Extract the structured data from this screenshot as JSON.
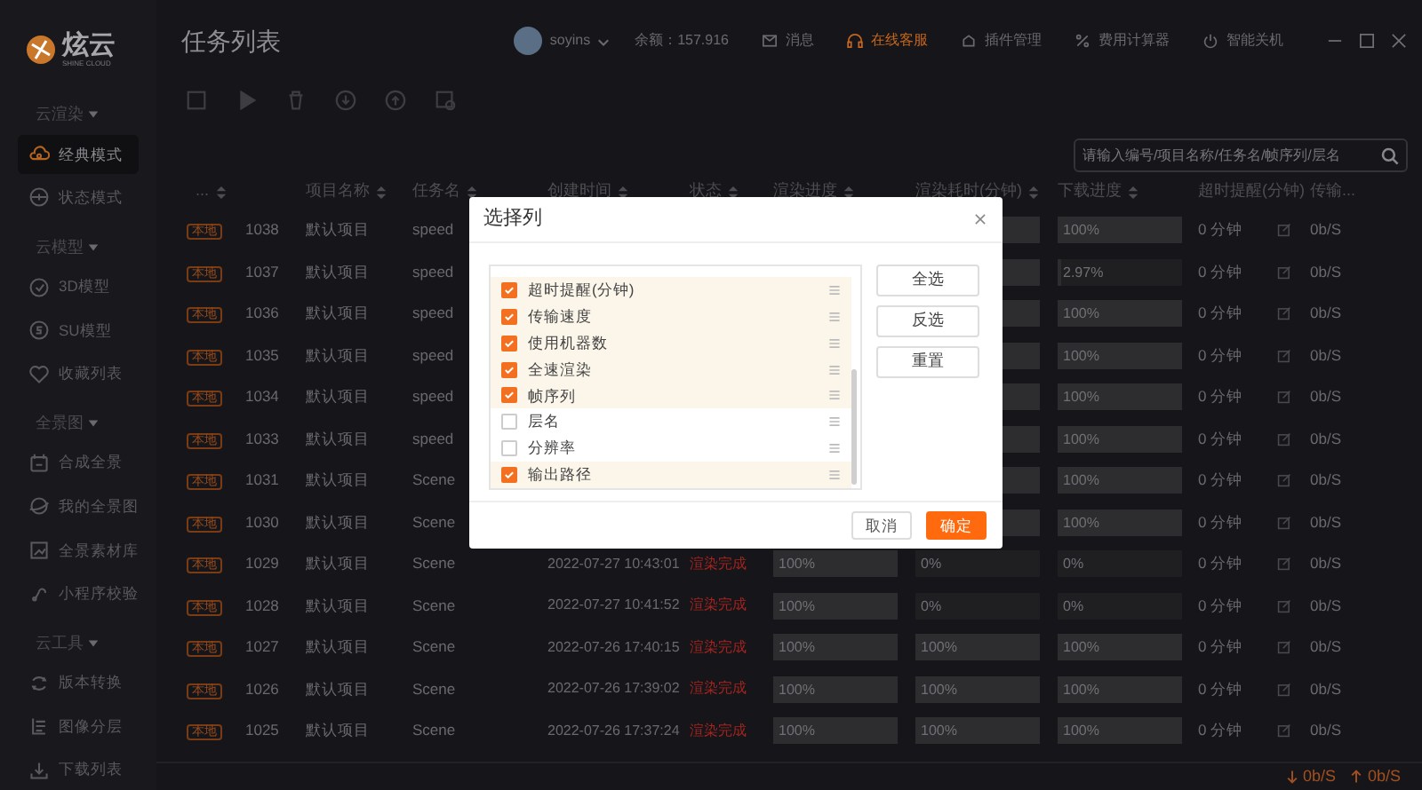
{
  "sidebar": {
    "logo": {
      "name": "炫云",
      "subtitle": "SHINE CLOUD"
    },
    "groups": [
      {
        "title": "云渲染",
        "items": [
          {
            "label": "经典模式",
            "selected": true
          },
          {
            "label": "状态模式",
            "selected": false
          }
        ]
      },
      {
        "title": "云模型",
        "items": [
          {
            "label": "3D模型",
            "selected": false
          },
          {
            "label": "SU模型",
            "selected": false
          },
          {
            "label": "收藏列表",
            "selected": false
          }
        ]
      },
      {
        "title": "全景图",
        "items": [
          {
            "label": "合成全景",
            "selected": false
          },
          {
            "label": "我的全景图",
            "selected": false
          },
          {
            "label": "全景素材库",
            "selected": false
          },
          {
            "label": "小程序校验",
            "selected": false
          }
        ]
      },
      {
        "title": "云工具",
        "items": [
          {
            "label": "版本转换",
            "selected": false
          },
          {
            "label": "图像分层",
            "selected": false
          },
          {
            "label": "下载列表",
            "selected": false
          }
        ]
      }
    ]
  },
  "header": {
    "title": "任务列表",
    "user": "soyins",
    "balance": "余额：157.916",
    "actions": [
      {
        "label": "消息",
        "selected": false
      },
      {
        "label": "在线客服",
        "selected": true
      },
      {
        "label": "插件管理",
        "selected": false
      },
      {
        "label": "费用计算器",
        "selected": false
      },
      {
        "label": "智能关机",
        "selected": false
      }
    ]
  },
  "search": {
    "placeholder": "请输入编号/项目名称/任务名/帧序列/层名"
  },
  "table": {
    "columns": [
      "...",
      "项目名称",
      "任务名",
      "创建时间",
      "状态",
      "渲染进度",
      "渲染耗时(分钟)",
      "下载进度",
      "超时提醒(分钟)",
      "传输..."
    ],
    "rows": [
      {
        "tag": "本地",
        "id": "1038",
        "project": "默认项目",
        "task": "speed",
        "elapsed": {
          "level": 1
        },
        "download": {
          "text": "100%",
          "level": 1
        },
        "timeout": "0 分钟",
        "speed": "0b/S"
      },
      {
        "tag": "本地",
        "id": "1037",
        "project": "默认项目",
        "task": "speed",
        "elapsed": {
          "level": 1
        },
        "download": {
          "text": "2.97%",
          "level": 0.03
        },
        "timeout": "0 分钟",
        "speed": "0b/S"
      },
      {
        "tag": "本地",
        "id": "1036",
        "project": "默认项目",
        "task": "speed",
        "elapsed": {
          "level": 1
        },
        "download": {
          "text": "100%",
          "level": 1
        },
        "timeout": "0 分钟",
        "speed": "0b/S"
      },
      {
        "tag": "本地",
        "id": "1035",
        "project": "默认项目",
        "task": "speed",
        "elapsed": {
          "level": 1
        },
        "download": {
          "text": "100%",
          "level": 1
        },
        "timeout": "0 分钟",
        "speed": "0b/S"
      },
      {
        "tag": "本地",
        "id": "1034",
        "project": "默认项目",
        "task": "speed",
        "elapsed": {
          "level": 1
        },
        "download": {
          "text": "100%",
          "level": 1
        },
        "timeout": "0 分钟",
        "speed": "0b/S"
      },
      {
        "tag": "本地",
        "id": "1033",
        "project": "默认项目",
        "task": "speed",
        "elapsed": {
          "level": 1
        },
        "download": {
          "text": "100%",
          "level": 1
        },
        "timeout": "0 分钟",
        "speed": "0b/S"
      },
      {
        "tag": "本地",
        "id": "1031",
        "project": "默认项目",
        "task": "Scene",
        "elapsed": {
          "level": 1
        },
        "download": {
          "text": "100%",
          "level": 1
        },
        "timeout": "0 分钟",
        "speed": "0b/S"
      },
      {
        "tag": "本地",
        "id": "1030",
        "project": "默认项目",
        "task": "Scene",
        "elapsed": {
          "level": 1
        },
        "download": {
          "text": "100%",
          "level": 1
        },
        "timeout": "0 分钟",
        "speed": "0b/S"
      },
      {
        "tag": "本地",
        "id": "1029",
        "project": "默认项目",
        "task": "Scene",
        "time": "2022-07-27 10:43:01",
        "status": "渲染完成",
        "progress": {
          "text": "100%",
          "level": 1
        },
        "elapsed": {
          "text": "0%",
          "level": 0
        },
        "download": {
          "text": "0%",
          "level": 0
        },
        "timeout": "0 分钟",
        "speed": "0b/S"
      },
      {
        "tag": "本地",
        "id": "1028",
        "project": "默认项目",
        "task": "Scene",
        "time": "2022-07-27 10:41:52",
        "status": "渲染完成",
        "progress": {
          "text": "100%",
          "level": 1
        },
        "elapsed": {
          "text": "0%",
          "level": 0
        },
        "download": {
          "text": "0%",
          "level": 0
        },
        "timeout": "0 分钟",
        "speed": "0b/S"
      },
      {
        "tag": "本地",
        "id": "1027",
        "project": "默认项目",
        "task": "Scene",
        "time": "2022-07-26 17:40:15",
        "status": "渲染完成",
        "progress": {
          "text": "100%",
          "level": 1
        },
        "elapsed": {
          "text": "100%",
          "level": 1
        },
        "download": {
          "text": "100%",
          "level": 1
        },
        "timeout": "0 分钟",
        "speed": "0b/S"
      },
      {
        "tag": "本地",
        "id": "1026",
        "project": "默认项目",
        "task": "Scene",
        "time": "2022-07-26 17:39:02",
        "status": "渲染完成",
        "progress": {
          "text": "100%",
          "level": 1
        },
        "elapsed": {
          "text": "100%",
          "level": 1
        },
        "download": {
          "text": "100%",
          "level": 1
        },
        "timeout": "0 分钟",
        "speed": "0b/S"
      },
      {
        "tag": "本地",
        "id": "1025",
        "project": "默认项目",
        "task": "Scene",
        "time": "2022-07-26 17:37:24",
        "status": "渲染完成",
        "progress": {
          "text": "100%",
          "level": 1
        },
        "elapsed": {
          "text": "100%",
          "level": 1
        },
        "download": {
          "text": "100%",
          "level": 1
        },
        "timeout": "0 分钟",
        "speed": "0b/S"
      }
    ]
  },
  "dialog": {
    "title": "选择列",
    "items": [
      {
        "label": "超时提醒(分钟)",
        "checked": true
      },
      {
        "label": "传输速度",
        "checked": true
      },
      {
        "label": "使用机器数",
        "checked": true
      },
      {
        "label": "全速渲染",
        "checked": true
      },
      {
        "label": "帧序列",
        "checked": true
      },
      {
        "label": "层名",
        "checked": false
      },
      {
        "label": "分辨率",
        "checked": false
      },
      {
        "label": "输出路径",
        "checked": true
      }
    ],
    "side_buttons": [
      "全选",
      "反选",
      "重置"
    ],
    "cancel": "取消",
    "ok": "确定"
  },
  "status_bar": {
    "download": "0b/S",
    "upload": "0b/S"
  }
}
